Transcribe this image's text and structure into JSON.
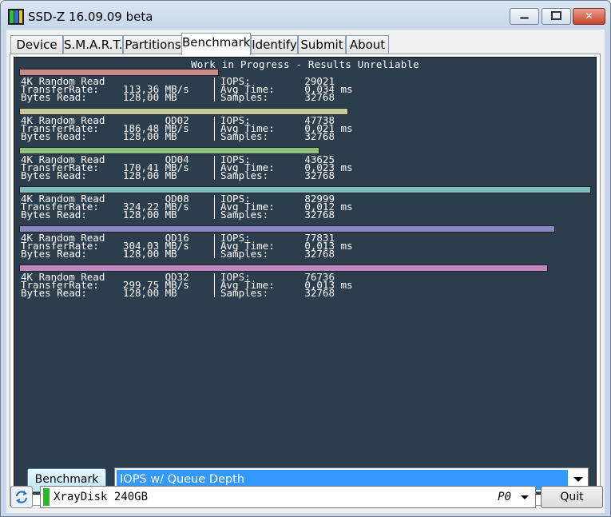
{
  "window": {
    "title": "SSD-Z 16.09.09 beta",
    "controls": {
      "minimize_icon": "minimize-icon",
      "maximize_icon": "maximize-icon",
      "close_icon": "close-icon"
    }
  },
  "tabs": [
    {
      "label": "Device",
      "active": false
    },
    {
      "label": "S.M.A.R.T.",
      "active": false
    },
    {
      "label": "Partitions",
      "active": false
    },
    {
      "label": "Benchmark",
      "active": true
    },
    {
      "label": "Identify",
      "active": false
    },
    {
      "label": "Submit",
      "active": false
    },
    {
      "label": "About",
      "active": false
    }
  ],
  "benchmark": {
    "banner": "Work in Progress - Results Unreliable",
    "labels": {
      "test": "4K Random Read",
      "transfer_rate": "TransferRate:",
      "bytes_read": "Bytes Read:",
      "iops": "IOPS:",
      "avg_time": "Avg Time:",
      "samples": "Samples:",
      "unit_rate": "MB/s",
      "unit_bytes": "MB",
      "unit_time": "ms"
    },
    "results": [
      {
        "qd": "",
        "transfer_rate": "113,36",
        "bytes_read": "128,00",
        "iops": "29021",
        "avg_time": "0,034",
        "samples": "32768",
        "bar_color": "#c98b8b",
        "bar_fraction": 0.3497
      },
      {
        "qd": "QD02",
        "transfer_rate": "186,48",
        "bytes_read": "128,00",
        "iops": "47738",
        "avg_time": "0,021",
        "samples": "32768",
        "bar_color": "#c8c99c",
        "bar_fraction": 0.5752
      },
      {
        "qd": "QD04",
        "transfer_rate": "170,41",
        "bytes_read": "128,00",
        "iops": "43625",
        "avg_time": "0,023",
        "samples": "32768",
        "bar_color": "#8fc281",
        "bar_fraction": 0.5256
      },
      {
        "qd": "QD08",
        "transfer_rate": "324,22",
        "bytes_read": "128,00",
        "iops": "82999",
        "avg_time": "0,012",
        "samples": "32768",
        "bar_color": "#7fbfbb",
        "bar_fraction": 1.0
      },
      {
        "qd": "QD16",
        "transfer_rate": "304,03",
        "bytes_read": "128,00",
        "iops": "77831",
        "avg_time": "0,013",
        "samples": "32768",
        "bar_color": "#8a86c6",
        "bar_fraction": 0.9377
      },
      {
        "qd": "QD32",
        "transfer_rate": "299,75",
        "bytes_read": "128,00",
        "iops": "76736",
        "avg_time": "0,013",
        "samples": "32768",
        "bar_color": "#c086c2",
        "bar_fraction": 0.9245
      }
    ],
    "run_button": "Benchmark",
    "mode_select": "IOPS w/ Queue Depth"
  },
  "footer": {
    "refresh_icon": "refresh-icon",
    "disk_name": "XrayDisk 240GB",
    "port": "P0",
    "quit_button": "Quit"
  },
  "colors": {
    "bench_background": "#2c3d4e",
    "selection": "#3399ff",
    "status_green": "#2db52d"
  }
}
